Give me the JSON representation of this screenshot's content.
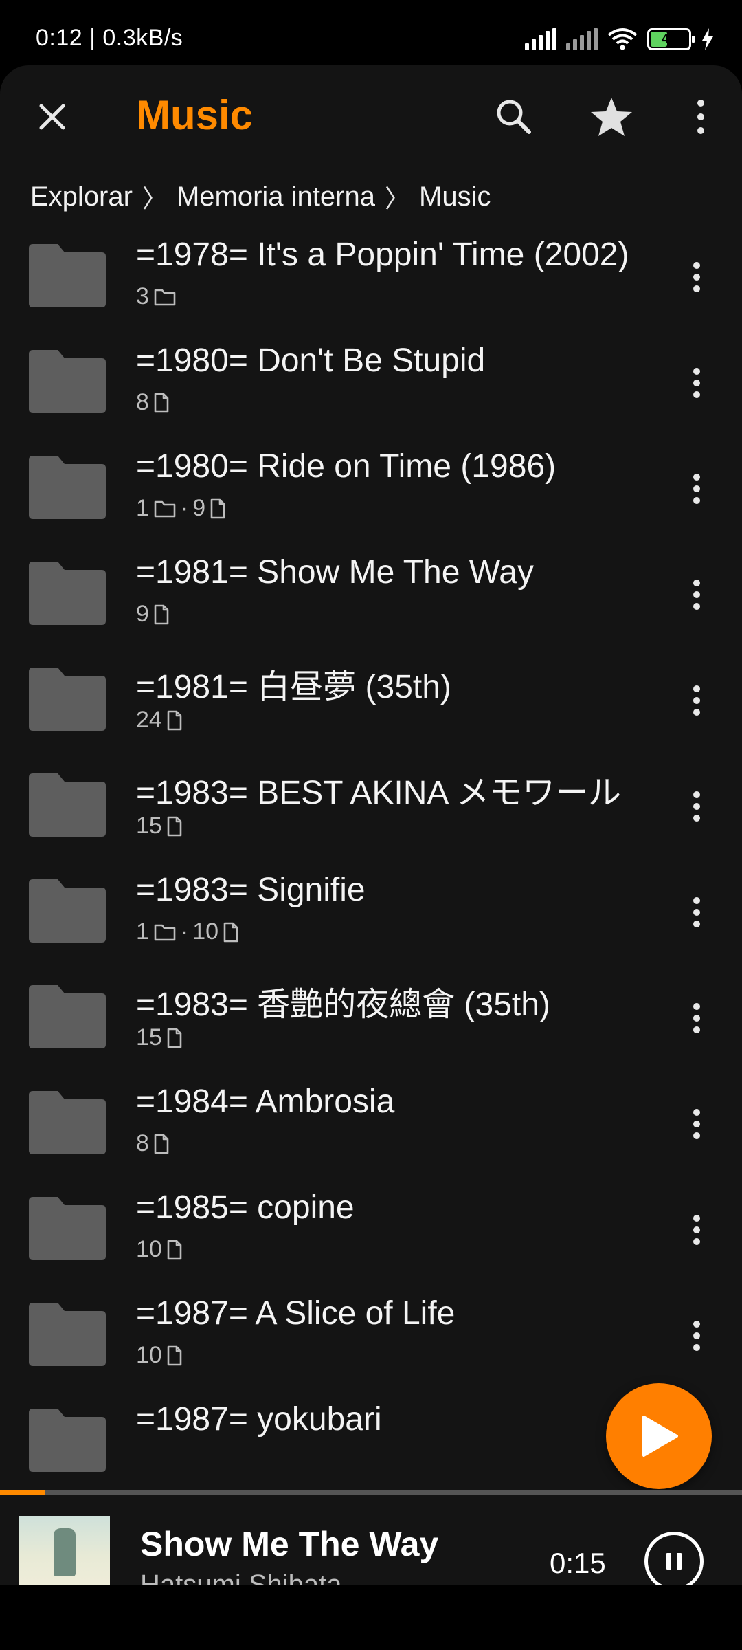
{
  "status": {
    "time_speed": "0:12 | 0.3kB/s",
    "battery": "46"
  },
  "toolbar": {
    "title": "Music"
  },
  "breadcrumb": [
    "Explorar",
    "Memoria interna",
    "Music"
  ],
  "colors": {
    "accent": "#ff8a00",
    "background": "#141414",
    "folder": "#5e5e5e"
  },
  "folders": [
    {
      "title": "=1978= It's a Poppin' Time (2002)",
      "dirs": "3",
      "files": ""
    },
    {
      "title": "=1980= Don't Be Stupid",
      "dirs": "",
      "files": "8"
    },
    {
      "title": "=1980= Ride on Time (1986)",
      "dirs": "1",
      "files": "9"
    },
    {
      "title": "=1981= Show Me The Way",
      "dirs": "",
      "files": "9"
    },
    {
      "title": "=1981= 白昼夢 (35th)",
      "dirs": "",
      "files": "24"
    },
    {
      "title": "=1983= BEST AKINA メモワール",
      "dirs": "",
      "files": "15"
    },
    {
      "title": "=1983= Signifie",
      "dirs": "1",
      "files": "10"
    },
    {
      "title": "=1983= 香艶的夜總會 (35th)",
      "dirs": "",
      "files": "15"
    },
    {
      "title": "=1984= Ambrosia",
      "dirs": "",
      "files": "8"
    },
    {
      "title": "=1985= copine",
      "dirs": "",
      "files": "10"
    },
    {
      "title": "=1987= A Slice of Life",
      "dirs": "",
      "files": "10"
    },
    {
      "title": "=1987= yokubari",
      "dirs": "",
      "files": ""
    }
  ],
  "player": {
    "title": "Show Me The Way",
    "artist": "Hatsumi Shibata",
    "elapsed": "0:15",
    "progress_fraction": 0.06
  }
}
